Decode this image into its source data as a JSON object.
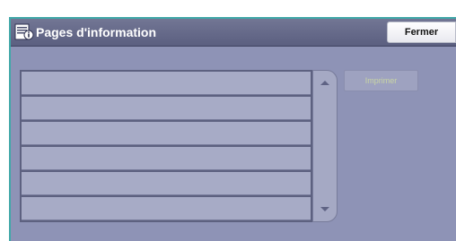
{
  "window": {
    "title": "Pages d'information",
    "title_icon": "information-pages-icon",
    "close_label": "Fermer"
  },
  "list": {
    "rows": [
      "",
      "",
      "",
      "",
      "",
      ""
    ],
    "scroll_up_icon": "chevron-up-icon",
    "scroll_down_icon": "chevron-down-icon"
  },
  "actions": {
    "print_label": "Imprimer",
    "print_enabled": false
  },
  "colors": {
    "accent": "#40a8a8",
    "titlebar": "#6a6e8d",
    "panel": "#8e93b6",
    "row": "#a7abc6",
    "disabled_text": "#c9d5a4"
  }
}
